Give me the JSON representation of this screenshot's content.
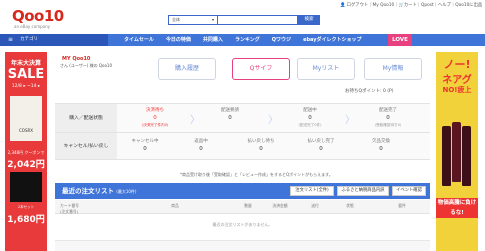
{
  "header": {
    "logo": "Qoo10",
    "logo_sub": "an eBay company",
    "search_select": "全体",
    "search_button": "検索",
    "util_links": "👤 ログアウト｜My Qoo10｜🛒カート｜Qpost｜ヘルプ｜Qoo10に出品"
  },
  "nav": {
    "category_label": "カテゴリ",
    "items": [
      "タイムセール",
      "今日の特価",
      "共同購入",
      "ランキング",
      "Qワウジ",
      "ebayダイレクトショップ"
    ],
    "love_label": "LOVE"
  },
  "left_banner": {
    "title1": "年末大決算",
    "title2": "SALE",
    "dates": "12/8 ▸ ~14 ▸",
    "brand": "COSRX",
    "price_note": "2,348円 クーポンで",
    "price": "2,042円",
    "label": "2本セット",
    "price2": "1,680円"
  },
  "right_banner": {
    "t1": "ノー!",
    "t2": "ネアグ",
    "t3": "NO!疲上",
    "bottom": "物価高騰に負けるな!"
  },
  "panel": {
    "q_logo": "MY Qoo10",
    "hello": "さん (ユーザー) 様の Qoo10",
    "tabs": [
      "購入履歴",
      "Qサイフ",
      "Myリスト",
      "My情報"
    ],
    "points": "お持ちQポイント: 0 (P)"
  },
  "status": {
    "row1_label": "購入／配送状態",
    "row1": [
      {
        "label": "決済待ち",
        "n": "0",
        "sub": "(決済完了件内0)",
        "red": true
      },
      {
        "label": "配送要請",
        "n": "0",
        "sub": "",
        "red": false
      },
      {
        "label": "配送中",
        "n": "0",
        "sub": "(配送完了0件)",
        "red": false
      },
      {
        "label": "配送完了",
        "n": "0",
        "sub": "(受取確認待ち0)",
        "red": false
      }
    ],
    "row2_label": "キャンセル/払い戻し",
    "row2": [
      {
        "label": "キャンセル中",
        "n": "0"
      },
      {
        "label": "返品中",
        "n": "0"
      },
      {
        "label": "払い戻し待ち",
        "n": "0"
      },
      {
        "label": "払い戻し完了",
        "n": "0"
      },
      {
        "label": "欠品交換",
        "n": "0"
      }
    ]
  },
  "note": "*商品受け取り後「受取確認」と「レビュー作成」をするとQポイントがもらえます。",
  "orders": {
    "title": "最近の注文リスト",
    "count": "(最大10件)",
    "buttons": [
      "注文リスト(全件)",
      "ふるさと納税商品内訳",
      "イベント確認"
    ],
    "columns": [
      "カート番号\n(注文番号)",
      "商品",
      "数量",
      "決済金額",
      "送付",
      "状態",
      "要件"
    ],
    "empty": "最近の注文リストがありません。"
  }
}
